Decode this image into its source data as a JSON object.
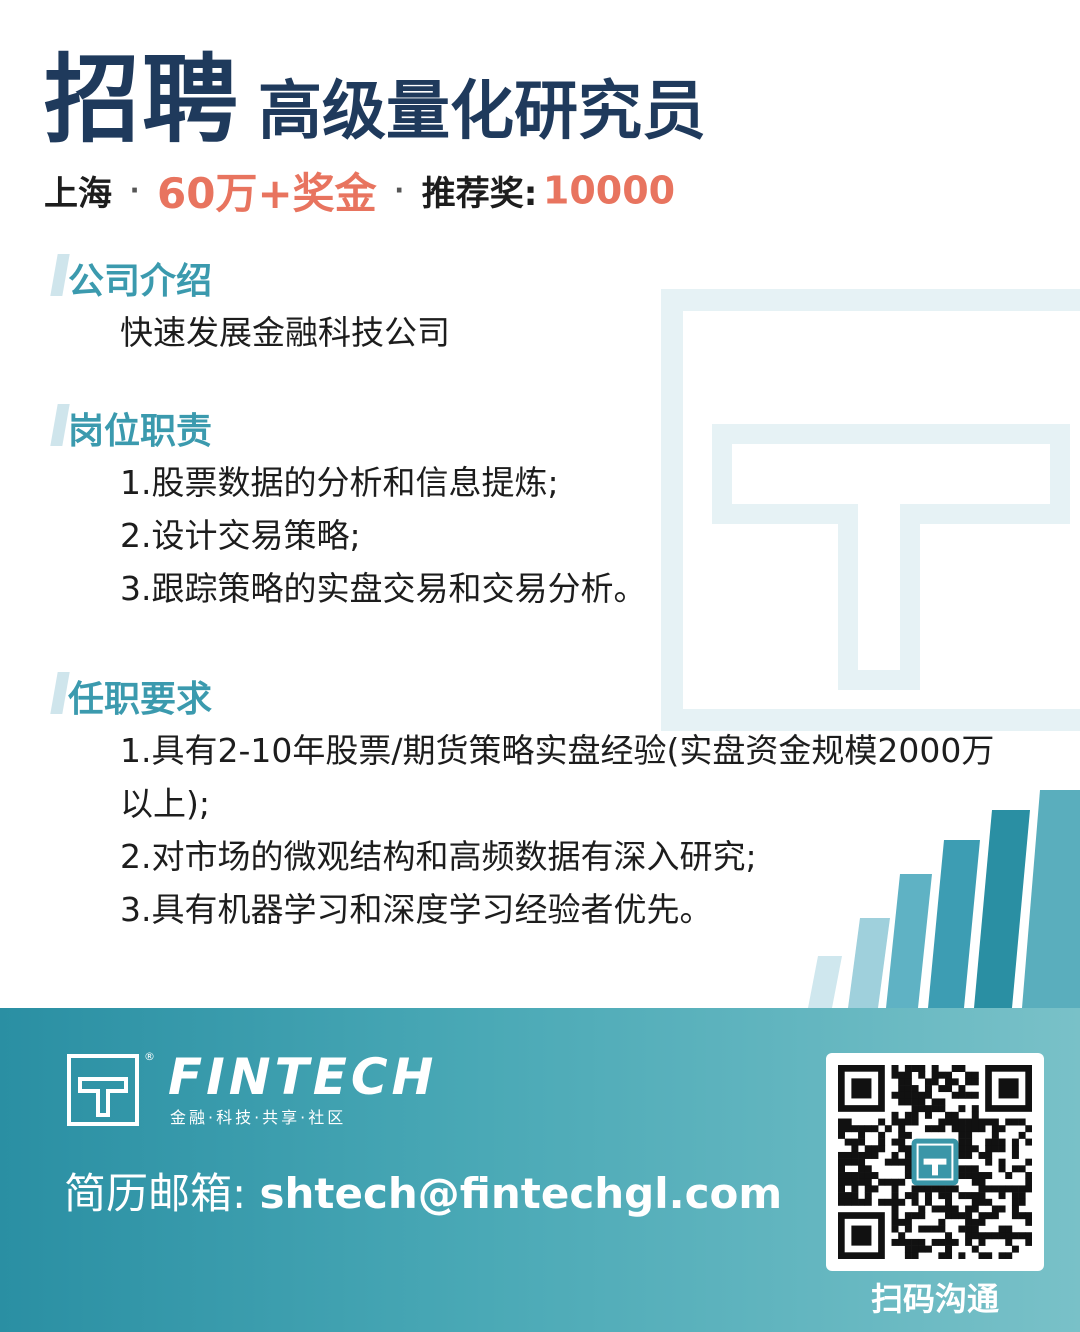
{
  "header": {
    "title_big": "招聘",
    "title_sub": "高级量化研究员"
  },
  "meta": {
    "city": "上海",
    "separator": "·",
    "salary": "60万+奖金",
    "referral_label": "推荐奖:",
    "referral_value": "10000"
  },
  "sections": {
    "company": {
      "title": "公司介绍",
      "items": [
        "快速发展金融科技公司"
      ]
    },
    "duties": {
      "title": "岗位职责",
      "items": [
        "1.股票数据的分析和信息提炼;",
        "2.设计交易策略;",
        "3.跟踪策略的实盘交易和交易分析。"
      ]
    },
    "requirements": {
      "title": "任职要求",
      "items": [
        "1.具有2-10年股票/期货策略实盘经验(实盘资金规模2000万以上);",
        "2.对市场的微观结构和高频数据有深入研究;",
        "3.具有机器学习和深度学习经验者优先。"
      ]
    }
  },
  "footer": {
    "brand": "FINTECH",
    "reg_mark": "®",
    "tagline": "金融·科技·共享·社区",
    "email_label": "简历邮箱:",
    "email_value": "shtech@fintechgl.com",
    "qr_caption": "扫码沟通"
  },
  "colors": {
    "title_navy": "#1f3a5c",
    "accent_orange": "#e8745f",
    "section_teal": "#3b9aae",
    "footer_teal": "#2a8fa3"
  },
  "icons": [
    "fintech-logo-icon",
    "qr-code-icon"
  ]
}
